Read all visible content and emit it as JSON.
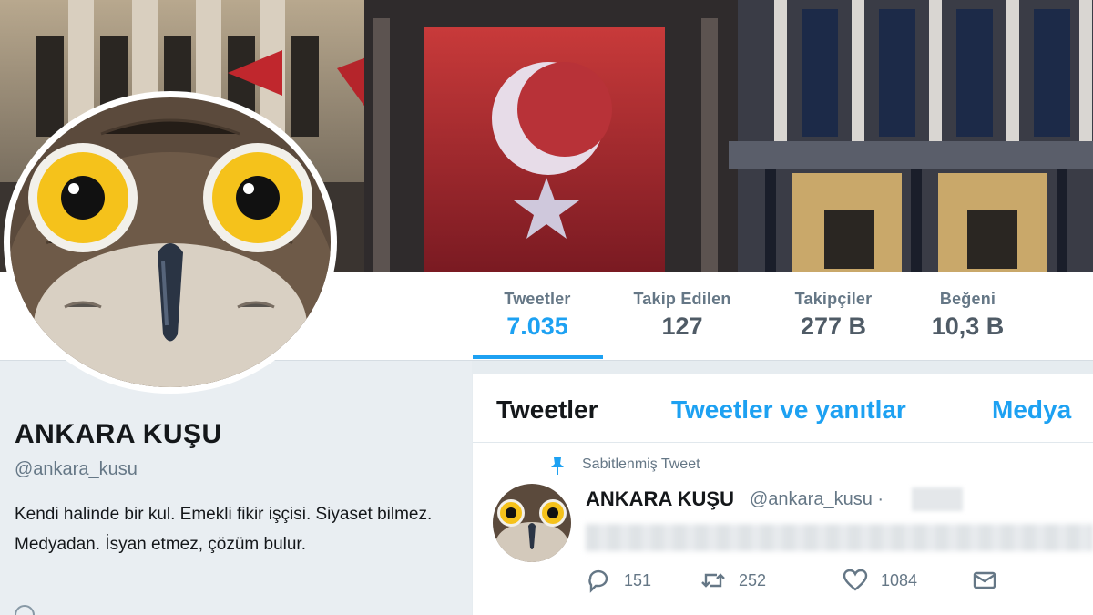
{
  "profile": {
    "name": "ANKARA KUŞU",
    "handle": "@ankara_kusu",
    "bio": "Kendi halinde bir kul. Emekli fikir işçisi. Siyaset bilmez. Medyadan. İsyan etmez, çözüm bulur."
  },
  "stats": [
    {
      "label": "Tweetler",
      "value": "7.035",
      "active": true
    },
    {
      "label": "Takip Edilen",
      "value": "127"
    },
    {
      "label": "Takipçiler",
      "value": "277 B"
    },
    {
      "label": "Beğeni",
      "value": "10,3 B"
    }
  ],
  "tabs": [
    {
      "label": "Tweetler",
      "active": true
    },
    {
      "label": "Tweetler ve yanıtlar"
    },
    {
      "label": "Medya"
    }
  ],
  "tweet": {
    "pinned_label": "Sabitlenmiş Tweet",
    "name": "ANKARA KUŞU",
    "handle": "@ankara_kusu ·",
    "replies": "151",
    "retweets": "252",
    "likes": "1084"
  },
  "colors": {
    "accent": "#1da1f2",
    "text": "#14171a",
    "muted": "#657786"
  },
  "icons": [
    "pin-icon",
    "reply-icon",
    "retweet-icon",
    "heart-icon",
    "message-icon",
    "location-icon"
  ]
}
